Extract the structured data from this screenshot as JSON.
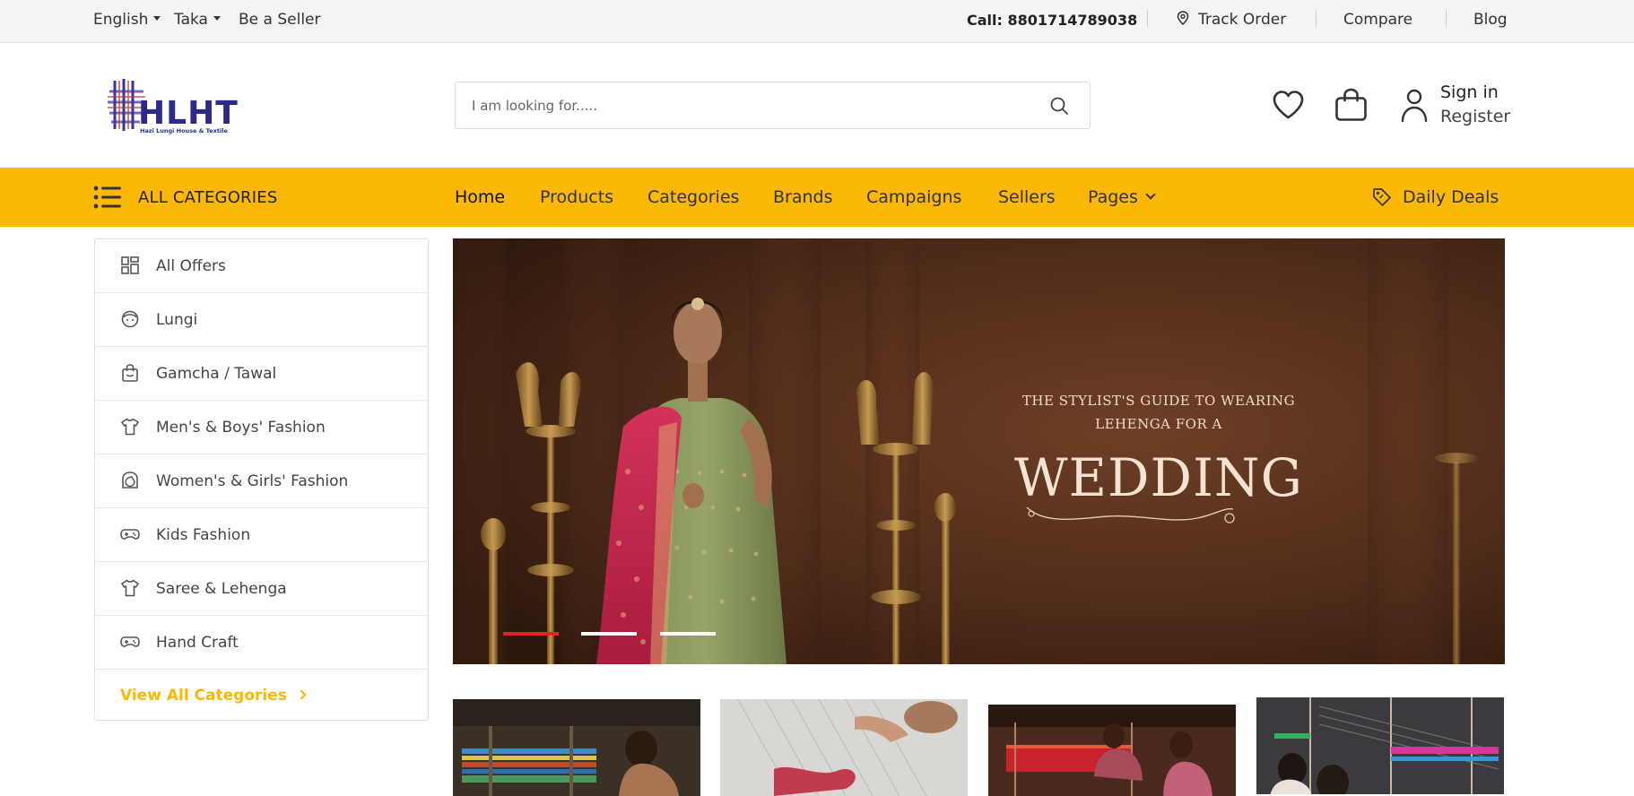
{
  "topbar": {
    "language": "English",
    "currency": "Taka",
    "seller_link": "Be a Seller",
    "call": "Call: 8801714789038",
    "track_order": "Track Order",
    "compare": "Compare",
    "blog": "Blog"
  },
  "header": {
    "logo_text": "HLHT",
    "logo_tagline": "Hazi Lungi House & Textile",
    "search_placeholder": "I am looking for.....",
    "sign_in": "Sign in",
    "register": "Register"
  },
  "nav": {
    "all_categories": "ALL CATEGORIES",
    "links": [
      "Home",
      "Products",
      "Categories",
      "Brands",
      "Campaigns",
      "Sellers",
      "Pages"
    ],
    "daily_deals": "Daily Deals"
  },
  "sidebar": {
    "items": [
      {
        "label": "All Offers",
        "icon": "grid-icon"
      },
      {
        "label": "Lungi",
        "icon": "face-icon"
      },
      {
        "label": "Gamcha / Tawal",
        "icon": "bag-icon"
      },
      {
        "label": "Men's & Boys' Fashion",
        "icon": "tshirt-icon"
      },
      {
        "label": "Women's & Girls' Fashion",
        "icon": "woman-icon"
      },
      {
        "label": "Kids Fashion",
        "icon": "gamepad-icon"
      },
      {
        "label": "Saree & Lehenga",
        "icon": "tshirt-icon"
      },
      {
        "label": "Hand Craft",
        "icon": "gamepad-icon"
      }
    ],
    "view_all": "View All Categories"
  },
  "banner": {
    "line1": "THE STYLIST'S GUIDE TO WEARING",
    "line2": "LEHENGA FOR A",
    "headline": "WEDDING",
    "slides": 3,
    "active_slide": 1
  },
  "colors": {
    "accent": "#fbb805",
    "slider_active": "#e32521",
    "logo_blue": "#2b2a8c"
  }
}
